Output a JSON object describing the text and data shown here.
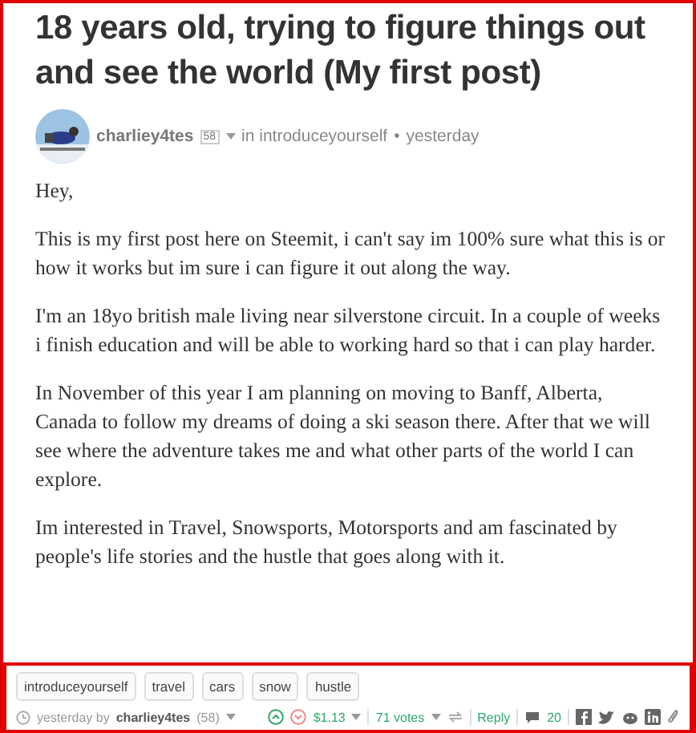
{
  "title": "18 years old, trying to figure things out and see the world (My first post)",
  "byline": {
    "author": "charliey4tes",
    "reputation": "58",
    "community": "in introduceyourself",
    "separator": "•",
    "time": "yesterday"
  },
  "paragraphs": [
    "Hey,",
    "This is my first post here on Steemit, i can't say im 100% sure what this is or how it works but im sure i can figure it out along the way.",
    "I'm an 18yo british male living near silverstone circuit. In a couple of weeks i finish education and will be able to working hard so that i can play harder.",
    "In November of this year I am planning on moving to Banff, Alberta, Canada to follow my dreams of doing a ski season there. After that we will see where the adventure takes me and what other parts of the world I can explore.",
    "Im interested in Travel, Snowsports, Motorsports and am fascinated by people's life stories and the hustle that goes along with it."
  ],
  "tags": [
    "introduceyourself",
    "travel",
    "cars",
    "snow",
    "hustle"
  ],
  "footer": {
    "time": "yesterday by",
    "author": "charliey4tes",
    "reputation": "(58)",
    "payout": "$1.13",
    "votes": "71 votes",
    "reply": "Reply",
    "comments": "20"
  }
}
